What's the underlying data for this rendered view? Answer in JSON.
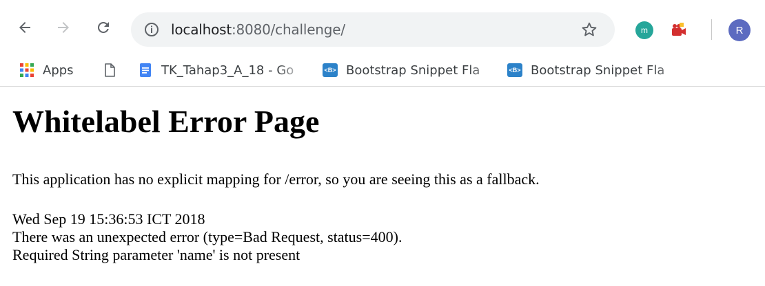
{
  "browser": {
    "url_host": "localhost",
    "url_port_path": ":8080/challenge/",
    "extension_label": "m",
    "profile_initial": "R"
  },
  "bookmarks": [
    {
      "label": "Apps",
      "icon": "apps-grid-icon"
    },
    {
      "label": "",
      "icon": "page-icon"
    },
    {
      "label": "TK_Tahap3_A_18 - Go",
      "icon": "google-docs-icon"
    },
    {
      "label": "Bootstrap Snippet Fla",
      "icon": "bootstrap-icon"
    },
    {
      "label": "Bootstrap Snippet Fla",
      "icon": "bootstrap-icon"
    }
  ],
  "bootstrap_icon_text": "<B>",
  "page": {
    "title": "Whitelabel Error Page",
    "message": "This application has no explicit mapping for /error, so you are seeing this as a fallback.",
    "timestamp": "Wed Sep 19 15:36:53 ICT 2018",
    "error_line": "There was an unexpected error (type=Bad Request, status=400).",
    "detail_line": "Required String parameter 'name' is not present"
  },
  "colors": {
    "omnibox_bg": "#f1f3f4",
    "bootstrap_blue": "#2c82c9",
    "avatar": "#5c6bc0",
    "extension_teal": "#26a69a"
  }
}
